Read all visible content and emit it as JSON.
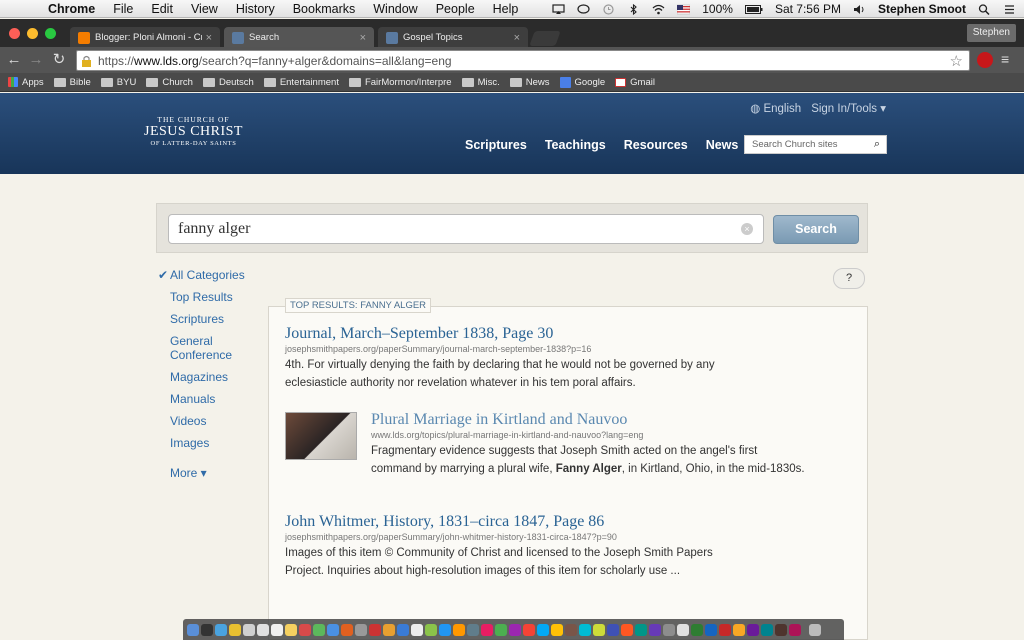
{
  "os_menubar": {
    "app_name": "Chrome",
    "menus": [
      "File",
      "Edit",
      "View",
      "History",
      "Bookmarks",
      "Window",
      "People",
      "Help"
    ],
    "battery": "100%",
    "clock": "Sat 7:56 PM",
    "user": "Stephen Smoot"
  },
  "browser": {
    "tabs": [
      {
        "label": "Blogger: Ploni Almoni - Cre",
        "favicon_color": "#f57d00",
        "active": false
      },
      {
        "label": "Search",
        "favicon_color": "#5a7aa0",
        "active": true
      },
      {
        "label": "Gospel Topics",
        "favicon_color": "#5a7aa0",
        "active": false
      }
    ],
    "profile_label": "Stephen",
    "url_protocol": "https://",
    "url_host": "www.lds.org",
    "url_path": "/search?q=fanny+alger&domains=all&lang=eng",
    "bookmarks": [
      "Apps",
      "Bible",
      "BYU",
      "Church",
      "Deutsch",
      "Entertainment",
      "FairMormon/Interpre",
      "Misc.",
      "News",
      "Google",
      "Gmail"
    ]
  },
  "site_header": {
    "logo": {
      "line1": "THE CHURCH OF",
      "line2": "JESUS CHRIST",
      "line3": "OF LATTER-DAY SAINTS"
    },
    "language": "English",
    "sign_in": "Sign In/Tools ▾",
    "nav": [
      "Scriptures",
      "Teachings",
      "Resources",
      "News"
    ],
    "search_placeholder": "Search Church sites"
  },
  "search": {
    "query": "fanny alger",
    "button_label": "Search",
    "help_label": "?"
  },
  "categories": {
    "selected": "All Categories",
    "items": [
      "Top Results",
      "Scriptures",
      "General Conference",
      "Magazines",
      "Manuals",
      "Videos",
      "Images"
    ],
    "more": "More ▾"
  },
  "results": {
    "section_label": "TOP RESULTS: FANNY ALGER",
    "items": [
      {
        "title": "Journal, March–September 1838, Page 30",
        "url": "josephsmithpapers.org/paperSummary/journal-march-september-1838?p=16",
        "desc": "4th. For virtually denying the faith by declaring that he would not be governed by any eclesiasticle authority nor revelation whatever in his tem poral affairs."
      },
      {
        "title": "Plural Marriage in Kirtland and Nauvoo",
        "url": "www.lds.org/topics/plural-marriage-in-kirtland-and-nauvoo?lang=eng",
        "desc_before": "Fragmentary evidence suggests that Joseph Smith acted on the angel's first command by marrying a plural wife, ",
        "desc_bold": "Fanny Alger",
        "desc_after": ", in Kirtland, Ohio, in the mid-1830s."
      },
      {
        "title": "John Whitmer, History, 1831–circa 1847, Page 86",
        "url": "josephsmithpapers.org/paperSummary/john-whitmer-history-1831-circa-1847?p=90",
        "desc": "Images of this item © Community of Christ and licensed to the Joseph Smith Papers Project. Inquiries about high-resolution images of this item for scholarly use ..."
      }
    ]
  }
}
